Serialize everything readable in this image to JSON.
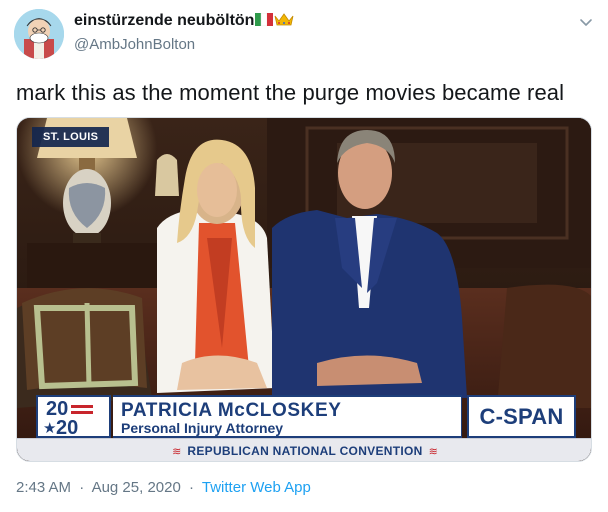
{
  "author": {
    "display_name": "einstürzende neuböltön",
    "handle": "@AmbJohnBolton",
    "avatar_icon": "cartoon-portrait-avatar",
    "name_emojis": [
      "italy-flag-icon",
      "crown-icon"
    ]
  },
  "tweet": {
    "text": "mark this as the moment the purge movies became real",
    "time": "2:43 AM",
    "date": "Aug 25, 2020",
    "separator": "·",
    "source": "Twitter Web App"
  },
  "media": {
    "location_tag": "ST. LOUIS",
    "chyron": {
      "logo_top": "20",
      "logo_bottom": "20",
      "logo_star": "★",
      "name": "PATRICIA McCLOSKEY",
      "title": "Personal Injury Attorney",
      "network": "C-SPAN",
      "event": "REPUBLICAN NATIONAL CONVENTION"
    }
  },
  "colors": {
    "link": "#1da1f2",
    "secondary_text": "#657786",
    "chyron_blue": "#1d3e7a",
    "chyron_red": "#c8252c"
  }
}
